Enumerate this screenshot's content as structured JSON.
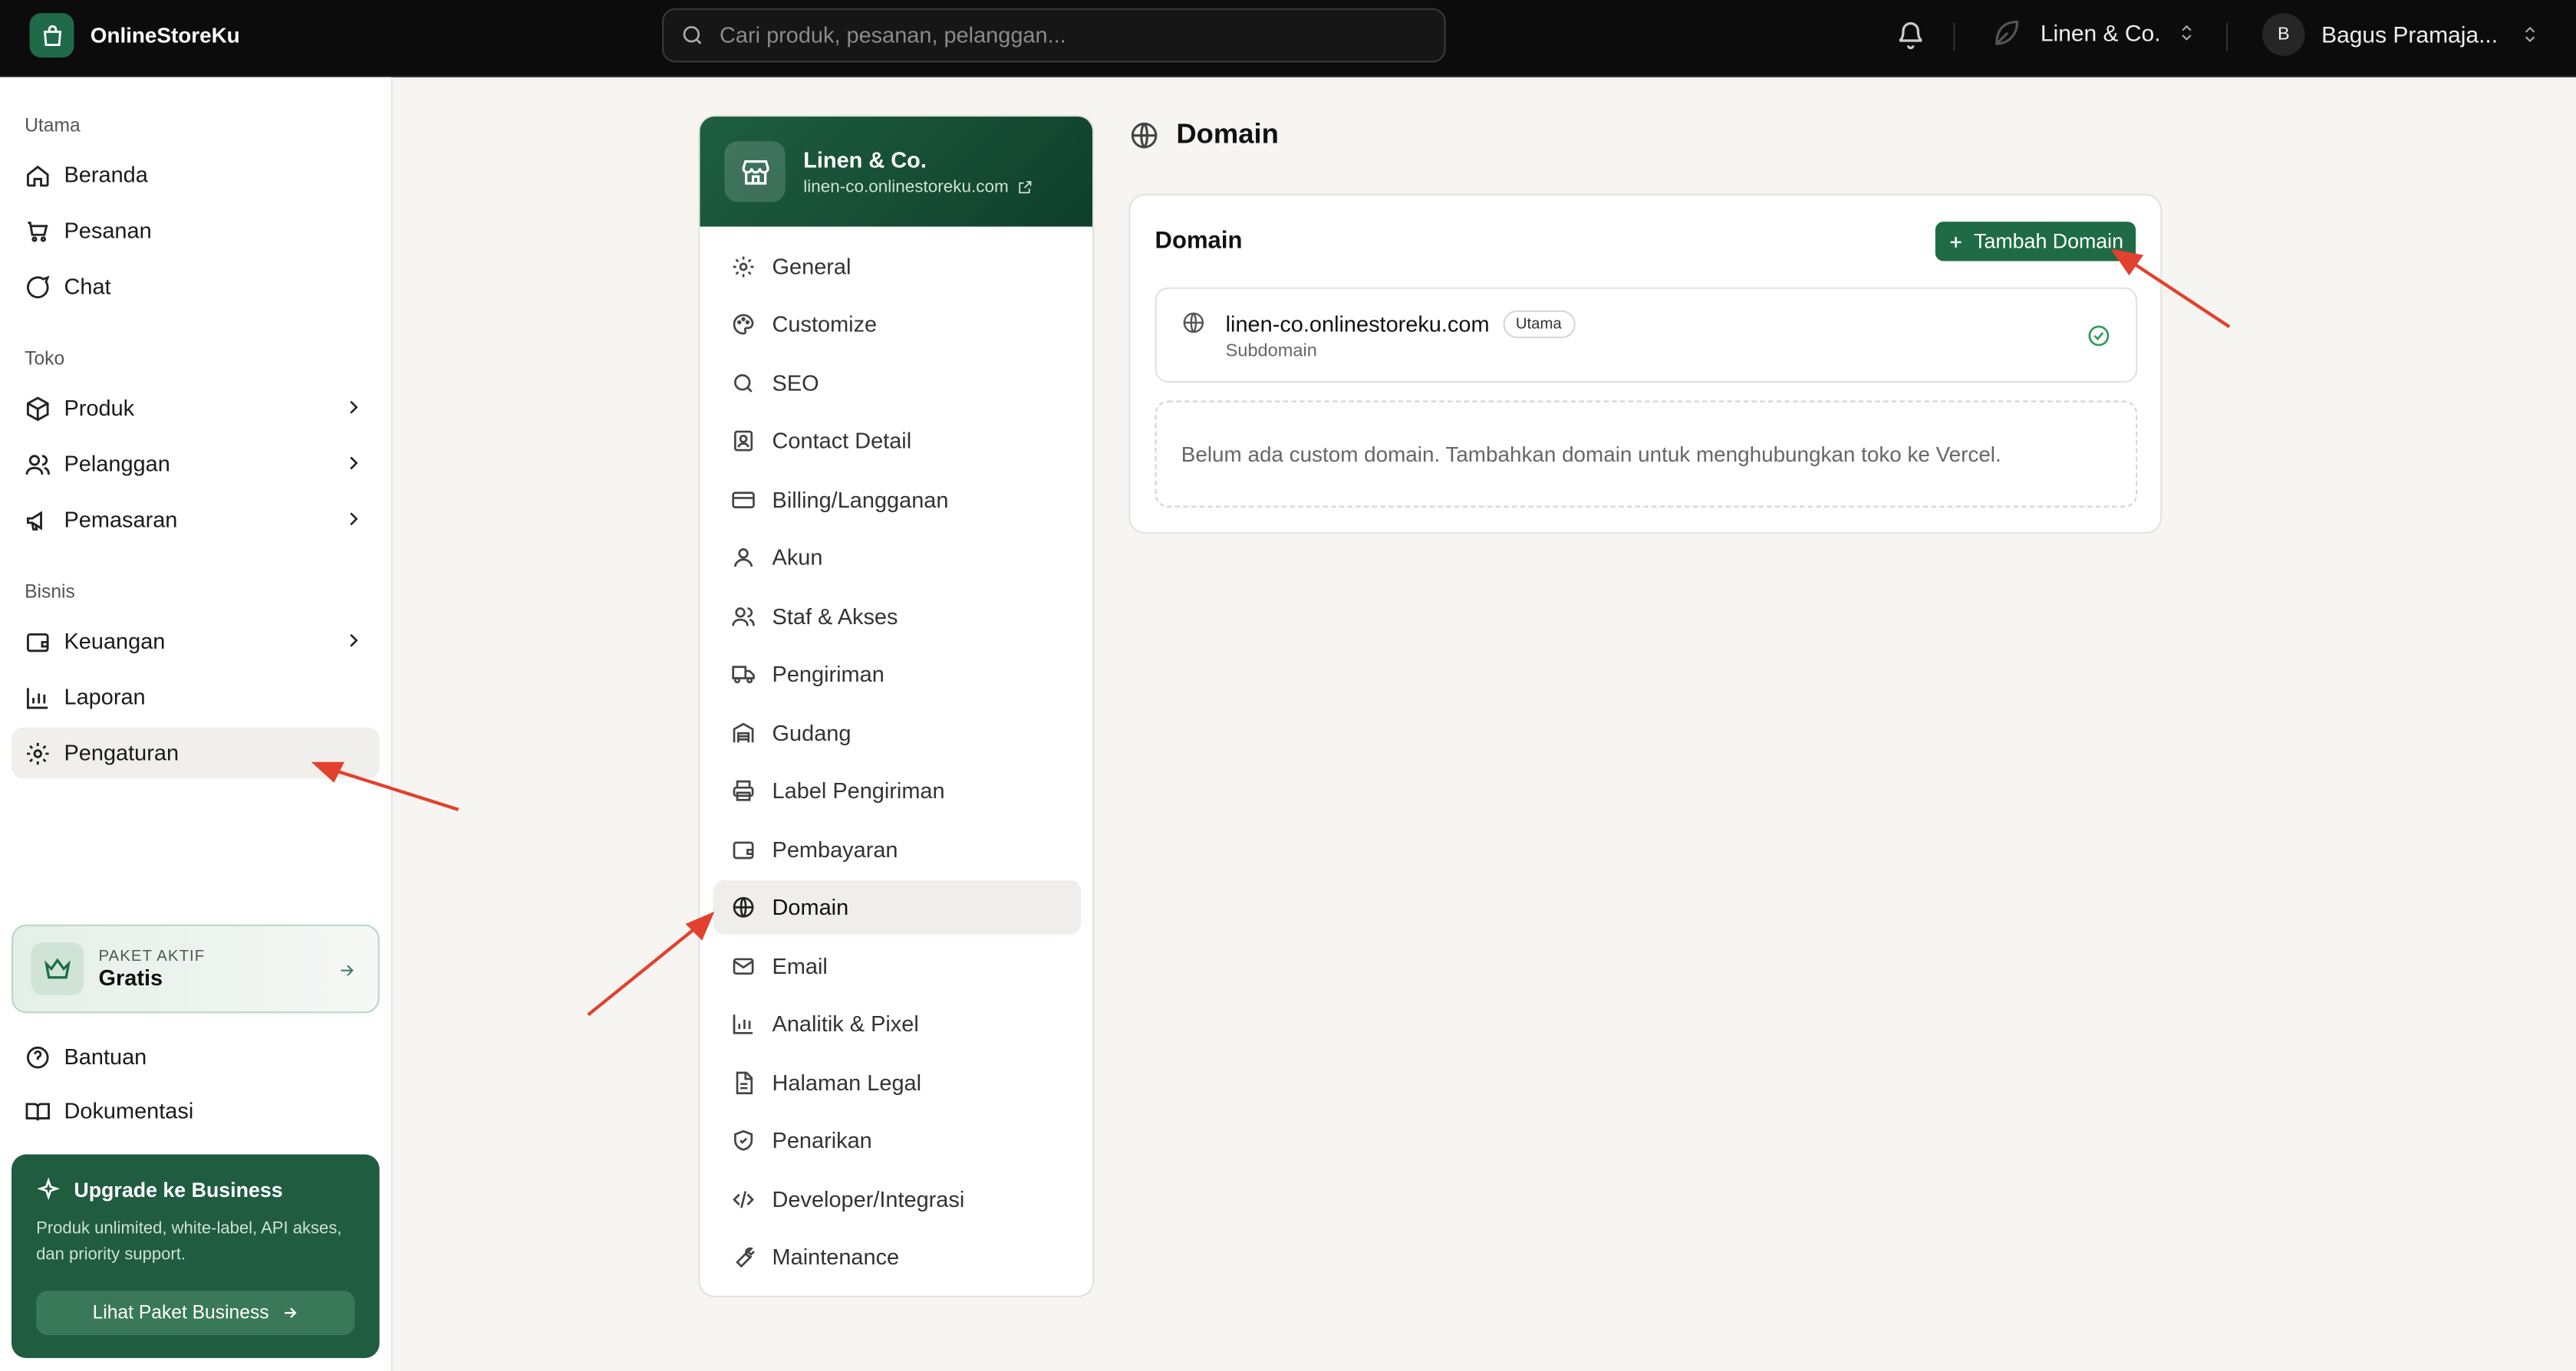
{
  "app": {
    "name": "OnlineStoreKu"
  },
  "search": {
    "placeholder": "Cari produk, pesanan, pelanggan..."
  },
  "header": {
    "store_name": "Linen & Co.",
    "user_name": "Bagus Pramaja...",
    "user_initial": "B"
  },
  "sidebar": {
    "sections": [
      "Utama",
      "Toko",
      "Bisnis"
    ],
    "main_items": [
      {
        "label": "Beranda",
        "icon": "home-icon"
      },
      {
        "label": "Pesanan",
        "icon": "cart-icon"
      },
      {
        "label": "Chat",
        "icon": "chat-icon"
      }
    ],
    "store_items": [
      {
        "label": "Produk",
        "icon": "box-icon"
      },
      {
        "label": "Pelanggan",
        "icon": "users-icon"
      },
      {
        "label": "Pemasaran",
        "icon": "megaphone-icon"
      }
    ],
    "business_items": [
      {
        "label": "Keuangan",
        "icon": "wallet-icon"
      },
      {
        "label": "Laporan",
        "icon": "chart-icon"
      },
      {
        "label": "Pengaturan",
        "icon": "gear-icon"
      }
    ],
    "plan": {
      "label": "PAKET AKTIF",
      "name": "Gratis"
    },
    "footer_items": [
      {
        "label": "Bantuan",
        "icon": "help-icon"
      },
      {
        "label": "Dokumentasi",
        "icon": "book-icon"
      }
    ],
    "upgrade": {
      "title": "Upgrade ke Business",
      "description": "Produk unlimited, white-label, API akses, dan priority support.",
      "button": "Lihat Paket Business"
    }
  },
  "settings": {
    "store_name": "Linen & Co.",
    "store_url": "linen-co.onlinestoreku.com",
    "menu": [
      "General",
      "Customize",
      "SEO",
      "Contact Detail",
      "Billing/Langganan",
      "Akun",
      "Staf & Akses",
      "Pengiriman",
      "Gudang",
      "Label Pengiriman",
      "Pembayaran",
      "Domain",
      "Email",
      "Analitik & Pixel",
      "Halaman Legal",
      "Penarikan",
      "Developer/Integrasi",
      "Maintenance"
    ],
    "active": "Domain"
  },
  "main": {
    "page_title": "Domain",
    "card_title": "Domain",
    "add_button": "Tambah Domain",
    "domain": {
      "name": "linen-co.onlinestoreku.com",
      "badge": "Utama",
      "type": "Subdomain"
    },
    "empty_message": "Belum ada custom domain. Tambahkan domain untuk menghubungkan toko ke Vercel."
  },
  "colors": {
    "brand_green": "#1f6b45",
    "topbar": "#0c0c0c",
    "annotation_red": "#e2412e"
  }
}
